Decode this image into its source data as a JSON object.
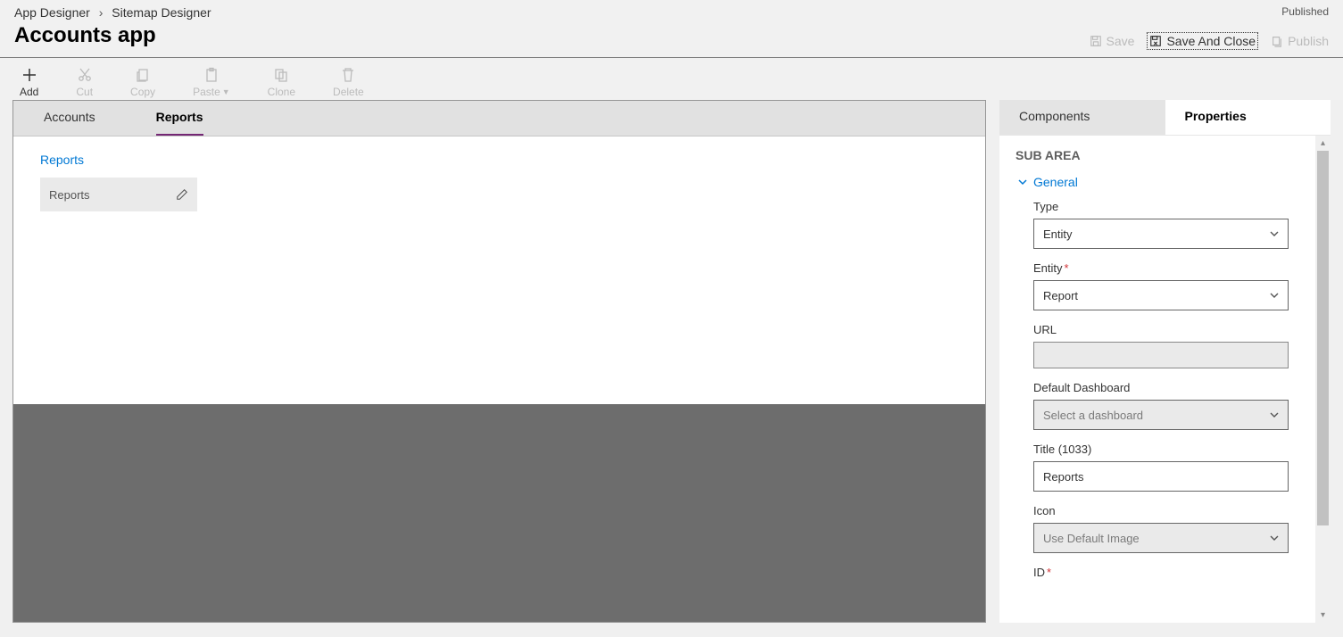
{
  "header": {
    "breadcrumb": {
      "root": "App Designer",
      "current": "Sitemap Designer"
    },
    "title": "Accounts app",
    "status": "Published",
    "actions": {
      "save": "Save",
      "save_and_close": "Save And Close",
      "publish": "Publish"
    }
  },
  "toolbar": {
    "add": "Add",
    "cut": "Cut",
    "copy": "Copy",
    "paste": "Paste",
    "clone": "Clone",
    "delete": "Delete"
  },
  "canvas": {
    "tabs": [
      "Accounts",
      "Reports"
    ],
    "active_tab": 1,
    "group": {
      "title": "Reports",
      "subarea": {
        "name": "Reports"
      }
    }
  },
  "side": {
    "tabs": {
      "components": "Components",
      "properties": "Properties"
    },
    "section_title": "SUB AREA",
    "general_label": "General",
    "fields": {
      "type": {
        "label": "Type",
        "value": "Entity"
      },
      "entity": {
        "label": "Entity",
        "value": "Report",
        "required": true
      },
      "url": {
        "label": "URL",
        "value": ""
      },
      "dash": {
        "label": "Default Dashboard",
        "placeholder": "Select a dashboard"
      },
      "title": {
        "label": "Title (1033)",
        "value": "Reports"
      },
      "icon": {
        "label": "Icon",
        "value": "Use Default Image"
      },
      "id": {
        "label": "ID",
        "required": true
      }
    }
  }
}
